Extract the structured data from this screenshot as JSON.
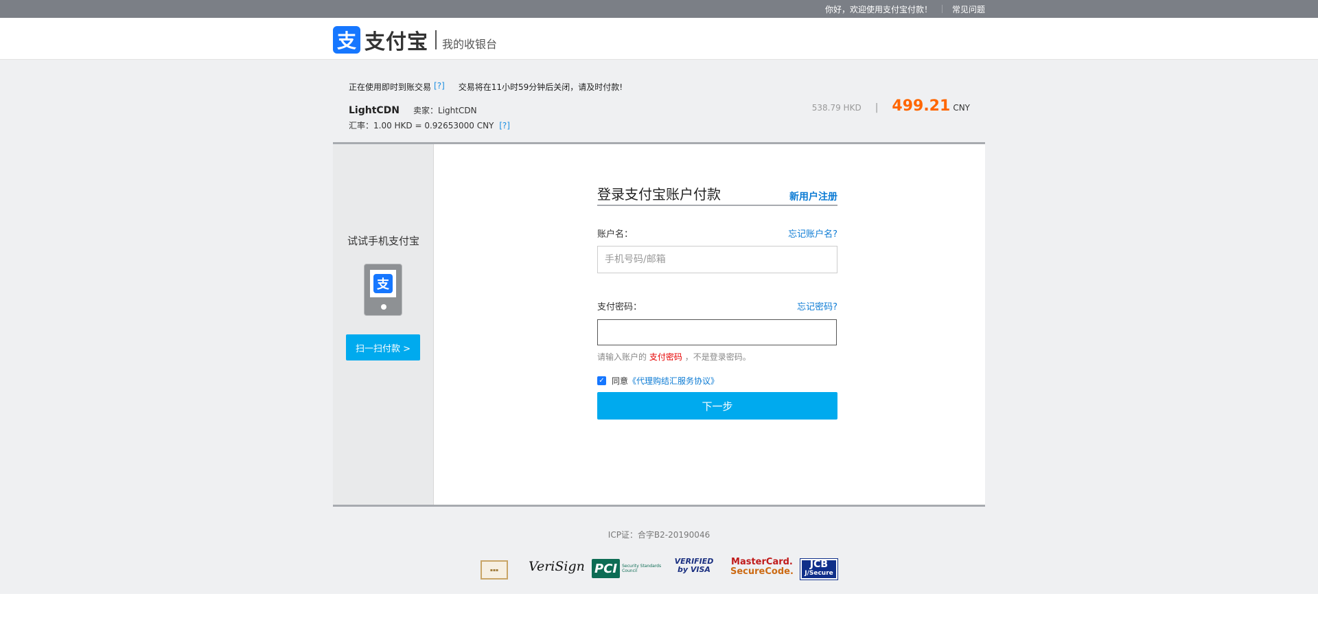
{
  "topbar": {
    "welcome": "你好，欢迎使用支付宝付款！",
    "faq": "常见问题"
  },
  "header": {
    "logo_mark": "支",
    "logo_text": "支付宝",
    "subtitle": "我的收银台"
  },
  "order": {
    "mode_text": "正在使用即时到账交易",
    "help_mark": "[?]",
    "closing_notice": "交易将在11小时59分钟后关闭，请及时付款!",
    "merchant": "LightCDN",
    "seller_label": "卖家：",
    "seller": "LightCDN",
    "rate_text": "汇率：1.00 HKD = 0.92653000 CNY",
    "amount_hkd": "538.79 HKD",
    "divider": "|",
    "amount_cny": "499.21",
    "currency": "CNY"
  },
  "side": {
    "title": "试试手机支付宝",
    "app_mark": "支",
    "scan_button": "扫一扫付款 >"
  },
  "login": {
    "title": "登录支付宝账户付款",
    "register": "新用户注册",
    "account_label": "账户名：",
    "forgot_account": "忘记账户名?",
    "account_placeholder": "手机号码/邮箱",
    "account_value": "",
    "password_label": "支付密码：",
    "forgot_password": "忘记密码?",
    "hint_prefix": "请输入账户的",
    "hint_red": "支付密码",
    "hint_suffix": "，不是登录密码。",
    "agree_prefix": "同意",
    "agree_link": "《代理购结汇服务协议》",
    "next_button": "下一步"
  },
  "footer": {
    "icp": "ICP证：合字B2-20190046",
    "badges": {
      "verisign": "VeriSign",
      "pci": "PCI",
      "pci_sub": "Security Standards Council",
      "visa_top": "VERIFIED",
      "visa_bottom": "by VISA",
      "mc_top": "MasterCard.",
      "mc_bottom": "SecureCode.",
      "jcb_top": "JCB",
      "jcb_bottom": "J/Secure"
    }
  },
  "colors": {
    "brand_blue": "#1677ff",
    "button_blue": "#00aaee",
    "link_blue": "#0c7bd4",
    "amount_orange": "#ff6600",
    "background_gray": "#eff0f2"
  }
}
